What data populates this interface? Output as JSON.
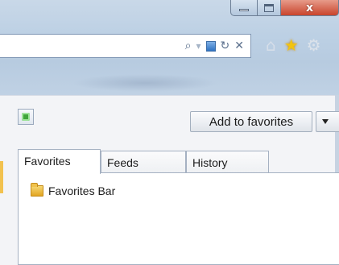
{
  "window": {
    "caption_buttons": {
      "minimize_icon": "minimize-icon",
      "maximize_icon": "maximize-icon",
      "close_glyph": "x"
    },
    "accent_color": "#c9442c"
  },
  "address_bar": {
    "icons": [
      "search-icon",
      "compatibility-view-icon",
      "refresh-icon",
      "stop-icon"
    ],
    "search_glyph": "⌕",
    "dropdown_glyph": "▾",
    "refresh_glyph": "↻",
    "stop_glyph": "✕"
  },
  "toolbar": {
    "icons": [
      "home-icon",
      "favorites-star-icon",
      "tools-gear-icon"
    ]
  },
  "favorites_center": {
    "pin_icon": "pin-favorites-center-icon",
    "add_button_label": "Add to favorites",
    "tabs": [
      {
        "label": "Favorites",
        "selected": true
      },
      {
        "label": "Feeds",
        "selected": false
      },
      {
        "label": "History",
        "selected": false
      }
    ],
    "items": [
      {
        "icon": "folder-icon",
        "label": "Favorites Bar"
      }
    ]
  }
}
